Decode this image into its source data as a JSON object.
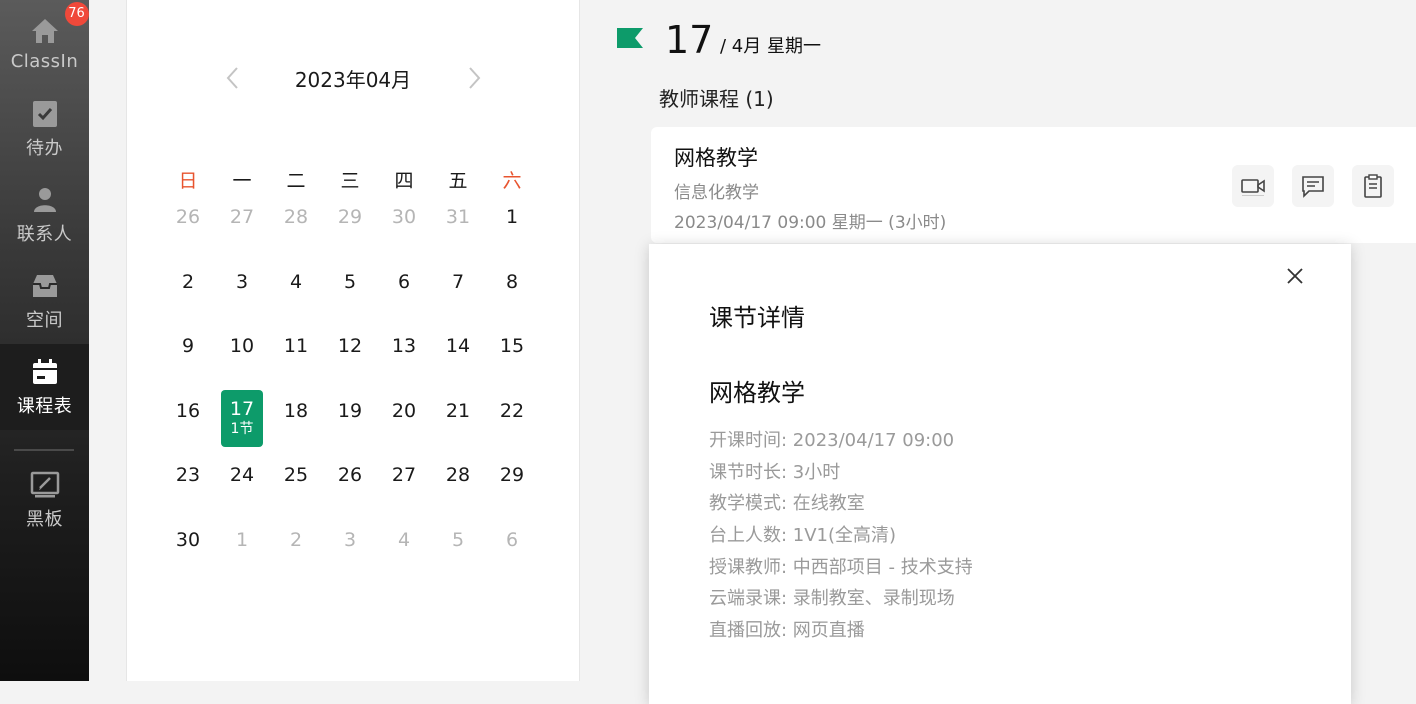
{
  "sidebar": {
    "items": [
      {
        "label": "ClassIn",
        "icon": "home-icon",
        "badge": "76"
      },
      {
        "label": "待办",
        "icon": "todo-icon"
      },
      {
        "label": "联系人",
        "icon": "contacts-icon"
      },
      {
        "label": "空间",
        "icon": "inbox-icon"
      },
      {
        "label": "课程表",
        "icon": "calendar-icon",
        "active": true
      },
      {
        "label": "黑板",
        "icon": "blackboard-icon"
      }
    ]
  },
  "calendar": {
    "month_title": "2023年04月",
    "weekdays": [
      "日",
      "一",
      "二",
      "三",
      "四",
      "五",
      "六"
    ],
    "weeks": [
      [
        {
          "d": "26",
          "m": true
        },
        {
          "d": "27",
          "m": true
        },
        {
          "d": "28",
          "m": true
        },
        {
          "d": "29",
          "m": true
        },
        {
          "d": "30",
          "m": true
        },
        {
          "d": "31",
          "m": true
        },
        {
          "d": "1"
        }
      ],
      [
        {
          "d": "2"
        },
        {
          "d": "3"
        },
        {
          "d": "4"
        },
        {
          "d": "5"
        },
        {
          "d": "6"
        },
        {
          "d": "7"
        },
        {
          "d": "8"
        }
      ],
      [
        {
          "d": "9"
        },
        {
          "d": "10"
        },
        {
          "d": "11"
        },
        {
          "d": "12"
        },
        {
          "d": "13"
        },
        {
          "d": "14"
        },
        {
          "d": "15"
        }
      ],
      [
        {
          "d": "16"
        },
        {
          "d": "17",
          "sel": true,
          "sub": "1节"
        },
        {
          "d": "18"
        },
        {
          "d": "19"
        },
        {
          "d": "20"
        },
        {
          "d": "21"
        },
        {
          "d": "22"
        }
      ],
      [
        {
          "d": "23"
        },
        {
          "d": "24"
        },
        {
          "d": "25"
        },
        {
          "d": "26"
        },
        {
          "d": "27"
        },
        {
          "d": "28"
        },
        {
          "d": "29"
        }
      ],
      [
        {
          "d": "30"
        },
        {
          "d": "1",
          "m": true
        },
        {
          "d": "2",
          "m": true
        },
        {
          "d": "3",
          "m": true
        },
        {
          "d": "4",
          "m": true
        },
        {
          "d": "5",
          "m": true
        },
        {
          "d": "6",
          "m": true
        }
      ]
    ]
  },
  "day": {
    "number": "17",
    "subtitle": "/  4月  星期一"
  },
  "section_title": "教师课程 (1)",
  "course": {
    "name": "网格教学",
    "subtitle": "信息化教学",
    "time": "2023/04/17 09:00 星期一 (3小时)"
  },
  "popup": {
    "title": "课节详情",
    "course_name": "网格教学",
    "details": [
      "开课时间: 2023/04/17 09:00",
      "课节时长: 3小时",
      "教学模式: 在线教室",
      "台上人数: 1V1(全高清)",
      "授课教师: 中西部项目 - 技术支持",
      "云端录课: 录制教室、录制现场",
      "直播回放: 网页直播"
    ]
  },
  "colors": {
    "accent": "#0d9b6a",
    "weekend": "#e8542f",
    "badge": "#f0493a"
  }
}
